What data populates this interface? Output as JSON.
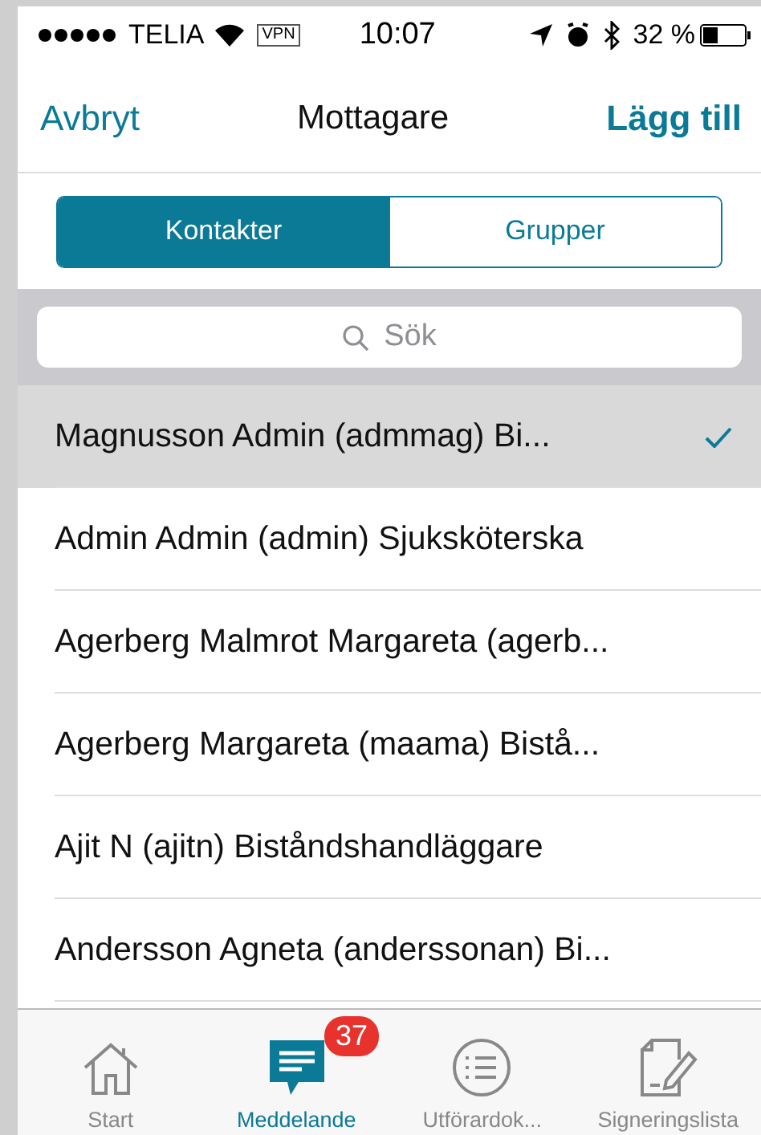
{
  "status_bar": {
    "carrier": "TELIA",
    "vpn": "VPN",
    "time": "10:07",
    "battery": "32 %"
  },
  "nav": {
    "left": "Avbryt",
    "title": "Mottagare",
    "right": "Lägg till"
  },
  "segments": [
    {
      "label": "Kontakter",
      "selected": true
    },
    {
      "label": "Grupper",
      "selected": false
    }
  ],
  "search": {
    "placeholder": "Sök"
  },
  "contacts": [
    {
      "name": "Magnusson Admin (admmag) Bi...",
      "selected": true
    },
    {
      "name": "Admin Admin (admin) Sjuksköterska",
      "selected": false
    },
    {
      "name": "Agerberg Malmrot Margareta (agerb...",
      "selected": false
    },
    {
      "name": "Agerberg Margareta (maama) Bistå...",
      "selected": false
    },
    {
      "name": "Ajit N (ajitn) Biståndshandläggare",
      "selected": false
    },
    {
      "name": "Andersson Agneta (anderssonan) Bi...",
      "selected": false
    }
  ],
  "tab_bar": [
    {
      "kind": "home",
      "label": "Start",
      "selected": false
    },
    {
      "kind": "chat",
      "label": "Meddelande",
      "selected": true,
      "badge": "37"
    },
    {
      "kind": "list",
      "label": "Utförardok...",
      "selected": false
    },
    {
      "kind": "sign",
      "label": "Signeringslista",
      "selected": false
    }
  ]
}
